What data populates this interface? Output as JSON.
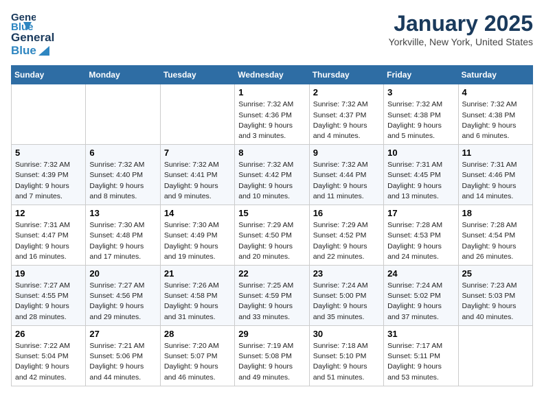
{
  "header": {
    "logo": {
      "line1": "General",
      "line2": "Blue"
    },
    "title": "January 2025",
    "location": "Yorkville, New York, United States"
  },
  "days_of_week": [
    "Sunday",
    "Monday",
    "Tuesday",
    "Wednesday",
    "Thursday",
    "Friday",
    "Saturday"
  ],
  "weeks": [
    [
      {
        "day": "",
        "info": ""
      },
      {
        "day": "",
        "info": ""
      },
      {
        "day": "",
        "info": ""
      },
      {
        "day": "1",
        "info": "Sunrise: 7:32 AM\nSunset: 4:36 PM\nDaylight: 9 hours\nand 3 minutes."
      },
      {
        "day": "2",
        "info": "Sunrise: 7:32 AM\nSunset: 4:37 PM\nDaylight: 9 hours\nand 4 minutes."
      },
      {
        "day": "3",
        "info": "Sunrise: 7:32 AM\nSunset: 4:38 PM\nDaylight: 9 hours\nand 5 minutes."
      },
      {
        "day": "4",
        "info": "Sunrise: 7:32 AM\nSunset: 4:38 PM\nDaylight: 9 hours\nand 6 minutes."
      }
    ],
    [
      {
        "day": "5",
        "info": "Sunrise: 7:32 AM\nSunset: 4:39 PM\nDaylight: 9 hours\nand 7 minutes."
      },
      {
        "day": "6",
        "info": "Sunrise: 7:32 AM\nSunset: 4:40 PM\nDaylight: 9 hours\nand 8 minutes."
      },
      {
        "day": "7",
        "info": "Sunrise: 7:32 AM\nSunset: 4:41 PM\nDaylight: 9 hours\nand 9 minutes."
      },
      {
        "day": "8",
        "info": "Sunrise: 7:32 AM\nSunset: 4:42 PM\nDaylight: 9 hours\nand 10 minutes."
      },
      {
        "day": "9",
        "info": "Sunrise: 7:32 AM\nSunset: 4:44 PM\nDaylight: 9 hours\nand 11 minutes."
      },
      {
        "day": "10",
        "info": "Sunrise: 7:31 AM\nSunset: 4:45 PM\nDaylight: 9 hours\nand 13 minutes."
      },
      {
        "day": "11",
        "info": "Sunrise: 7:31 AM\nSunset: 4:46 PM\nDaylight: 9 hours\nand 14 minutes."
      }
    ],
    [
      {
        "day": "12",
        "info": "Sunrise: 7:31 AM\nSunset: 4:47 PM\nDaylight: 9 hours\nand 16 minutes."
      },
      {
        "day": "13",
        "info": "Sunrise: 7:30 AM\nSunset: 4:48 PM\nDaylight: 9 hours\nand 17 minutes."
      },
      {
        "day": "14",
        "info": "Sunrise: 7:30 AM\nSunset: 4:49 PM\nDaylight: 9 hours\nand 19 minutes."
      },
      {
        "day": "15",
        "info": "Sunrise: 7:29 AM\nSunset: 4:50 PM\nDaylight: 9 hours\nand 20 minutes."
      },
      {
        "day": "16",
        "info": "Sunrise: 7:29 AM\nSunset: 4:52 PM\nDaylight: 9 hours\nand 22 minutes."
      },
      {
        "day": "17",
        "info": "Sunrise: 7:28 AM\nSunset: 4:53 PM\nDaylight: 9 hours\nand 24 minutes."
      },
      {
        "day": "18",
        "info": "Sunrise: 7:28 AM\nSunset: 4:54 PM\nDaylight: 9 hours\nand 26 minutes."
      }
    ],
    [
      {
        "day": "19",
        "info": "Sunrise: 7:27 AM\nSunset: 4:55 PM\nDaylight: 9 hours\nand 28 minutes."
      },
      {
        "day": "20",
        "info": "Sunrise: 7:27 AM\nSunset: 4:56 PM\nDaylight: 9 hours\nand 29 minutes."
      },
      {
        "day": "21",
        "info": "Sunrise: 7:26 AM\nSunset: 4:58 PM\nDaylight: 9 hours\nand 31 minutes."
      },
      {
        "day": "22",
        "info": "Sunrise: 7:25 AM\nSunset: 4:59 PM\nDaylight: 9 hours\nand 33 minutes."
      },
      {
        "day": "23",
        "info": "Sunrise: 7:24 AM\nSunset: 5:00 PM\nDaylight: 9 hours\nand 35 minutes."
      },
      {
        "day": "24",
        "info": "Sunrise: 7:24 AM\nSunset: 5:02 PM\nDaylight: 9 hours\nand 37 minutes."
      },
      {
        "day": "25",
        "info": "Sunrise: 7:23 AM\nSunset: 5:03 PM\nDaylight: 9 hours\nand 40 minutes."
      }
    ],
    [
      {
        "day": "26",
        "info": "Sunrise: 7:22 AM\nSunset: 5:04 PM\nDaylight: 9 hours\nand 42 minutes."
      },
      {
        "day": "27",
        "info": "Sunrise: 7:21 AM\nSunset: 5:06 PM\nDaylight: 9 hours\nand 44 minutes."
      },
      {
        "day": "28",
        "info": "Sunrise: 7:20 AM\nSunset: 5:07 PM\nDaylight: 9 hours\nand 46 minutes."
      },
      {
        "day": "29",
        "info": "Sunrise: 7:19 AM\nSunset: 5:08 PM\nDaylight: 9 hours\nand 49 minutes."
      },
      {
        "day": "30",
        "info": "Sunrise: 7:18 AM\nSunset: 5:10 PM\nDaylight: 9 hours\nand 51 minutes."
      },
      {
        "day": "31",
        "info": "Sunrise: 7:17 AM\nSunset: 5:11 PM\nDaylight: 9 hours\nand 53 minutes."
      },
      {
        "day": "",
        "info": ""
      }
    ]
  ]
}
